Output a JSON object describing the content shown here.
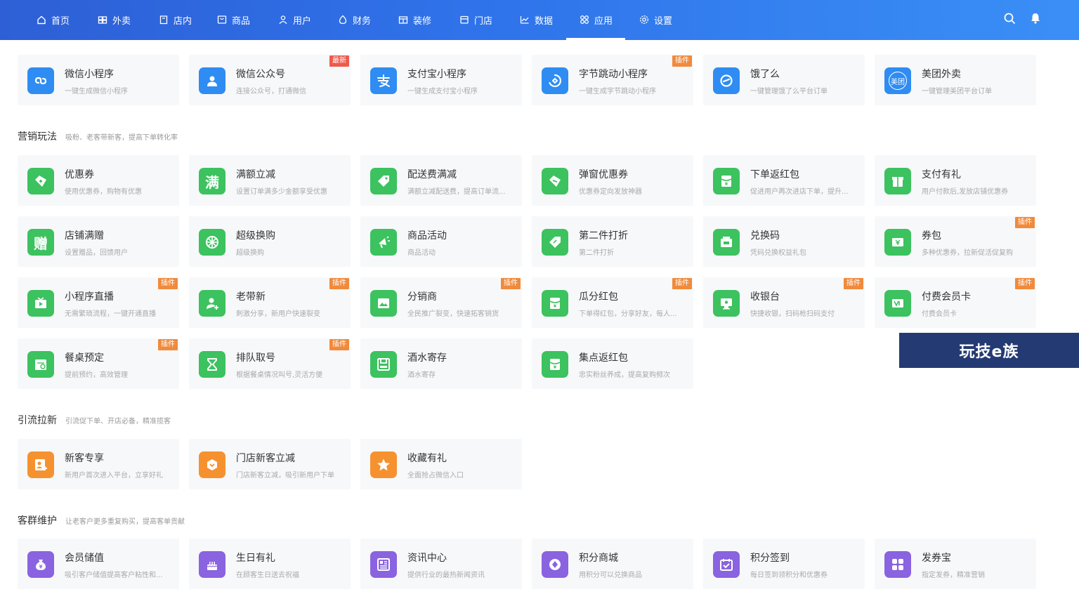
{
  "nav": {
    "items": [
      {
        "label": "首页",
        "icon": "home-icon"
      },
      {
        "label": "外卖",
        "icon": "takeout-icon"
      },
      {
        "label": "店内",
        "icon": "store-inside-icon"
      },
      {
        "label": "商品",
        "icon": "goods-icon"
      },
      {
        "label": "用户",
        "icon": "user-icon"
      },
      {
        "label": "财务",
        "icon": "finance-icon"
      },
      {
        "label": "装修",
        "icon": "decorate-icon"
      },
      {
        "label": "门店",
        "icon": "shop-icon"
      },
      {
        "label": "数据",
        "icon": "chart-icon"
      },
      {
        "label": "应用",
        "icon": "apps-icon"
      },
      {
        "label": "设置",
        "icon": "gear-icon"
      }
    ],
    "active": "应用"
  },
  "sections": {
    "channels": {
      "cards": [
        {
          "title": "微信小程序",
          "desc": "一键生成微信小程序",
          "icon": "wechat-miniapp-icon",
          "color": "#2f8cf2",
          "badge": ""
        },
        {
          "title": "微信公众号",
          "desc": "连接公众号，打通微信",
          "icon": "wechat-account-icon",
          "color": "#2f8cf2",
          "badge": "最新"
        },
        {
          "title": "支付宝小程序",
          "desc": "一键生成支付宝小程序",
          "icon": "alipay-icon",
          "color": "#2f8cf2",
          "badge": ""
        },
        {
          "title": "字节跳动小程序",
          "desc": "一键生成字节跳动小程序",
          "icon": "bytedance-icon",
          "color": "#2f8cf2",
          "badge": "插件"
        },
        {
          "title": "饿了么",
          "desc": "一键管理饿了么平台订单",
          "icon": "eleme-icon",
          "color": "#2f8cf2",
          "badge": ""
        },
        {
          "title": "美团外卖",
          "desc": "一键管理美团平台订单",
          "icon": "meituan-icon",
          "color": "#2f8cf2",
          "badge": "",
          "icon_text": "美团"
        }
      ]
    },
    "marketing": {
      "title": "营销玩法",
      "subtitle": "吸粉、老客带新客，提高下单转化率",
      "cards": [
        {
          "title": "优惠券",
          "desc": "使用优惠券，购物有优惠",
          "icon": "coupon-icon",
          "color": "#3cc25f",
          "badge": ""
        },
        {
          "title": "满额立减",
          "desc": "设置订单满多少金额享受优惠",
          "icon": "full-reduce-icon",
          "color": "#3cc25f",
          "badge": "",
          "icon_text": "满"
        },
        {
          "title": "配送费满减",
          "desc": "满额立减配送费，提高订单流...",
          "icon": "delivery-tag-icon",
          "color": "#3cc25f",
          "badge": ""
        },
        {
          "title": "弹窗优惠券",
          "desc": "优惠券定向发放神器",
          "icon": "popup-coupon-icon",
          "color": "#3cc25f",
          "badge": ""
        },
        {
          "title": "下单返红包",
          "desc": "促进用户再次进店下单，提升...",
          "icon": "redpacket-icon",
          "color": "#3cc25f",
          "badge": ""
        },
        {
          "title": "支付有礼",
          "desc": "用户付款后,发放店铺优惠券",
          "icon": "pay-gift-icon",
          "color": "#3cc25f",
          "badge": ""
        },
        {
          "title": "店铺满赠",
          "desc": "设置赠品，回馈用户",
          "icon": "gift-icon",
          "color": "#3cc25f",
          "badge": "",
          "icon_text": "赠"
        },
        {
          "title": "超级换购",
          "desc": "超级换购",
          "icon": "exchange-icon",
          "color": "#3cc25f",
          "badge": ""
        },
        {
          "title": "商品活动",
          "desc": "商品活动",
          "icon": "megaphone-icon",
          "color": "#3cc25f",
          "badge": ""
        },
        {
          "title": "第二件打折",
          "desc": "第二件打折",
          "icon": "discount-tag-icon",
          "color": "#3cc25f",
          "badge": ""
        },
        {
          "title": "兑换码",
          "desc": "凭码兑换权益礼包",
          "icon": "redeem-code-icon",
          "color": "#3cc25f",
          "badge": ""
        },
        {
          "title": "券包",
          "desc": "多种优惠券，拉新促活促复购",
          "icon": "coupon-pack-icon",
          "color": "#3cc25f",
          "badge": "插件"
        },
        {
          "title": "小程序直播",
          "desc": "无需繁琐流程，一键开通直播",
          "icon": "live-icon",
          "color": "#3cc25f",
          "badge": "插件"
        },
        {
          "title": "老带新",
          "desc": "刺激分享，新用户快速裂变",
          "icon": "invite-icon",
          "color": "#3cc25f",
          "badge": "插件"
        },
        {
          "title": "分销商",
          "desc": "全民推广裂变，快速拓客销货",
          "icon": "distributor-icon",
          "color": "#3cc25f",
          "badge": "插件"
        },
        {
          "title": "瓜分红包",
          "desc": "下单得红包，分享好友，每人...",
          "icon": "split-redpacket-icon",
          "color": "#3cc25f",
          "badge": "插件"
        },
        {
          "title": "收银台",
          "desc": "快捷收银，扫码枪扫码支付",
          "icon": "cashier-icon",
          "color": "#3cc25f",
          "badge": "插件"
        },
        {
          "title": "付费会员卡",
          "desc": "付费会员卡",
          "icon": "vip-card-icon",
          "color": "#3cc25f",
          "badge": "插件"
        },
        {
          "title": "餐桌预定",
          "desc": "提前预约，高效管理",
          "icon": "reservation-icon",
          "color": "#3cc25f",
          "badge": "插件"
        },
        {
          "title": "排队取号",
          "desc": "根据餐桌情况叫号,灵活方便",
          "icon": "hourglass-icon",
          "color": "#3cc25f",
          "badge": "插件"
        },
        {
          "title": "酒水寄存",
          "desc": "酒水寄存",
          "icon": "storage-icon",
          "color": "#3cc25f",
          "badge": ""
        },
        {
          "title": "集点返红包",
          "desc": "忠实粉丝养成，提高复购频次",
          "icon": "points-redpacket-icon",
          "color": "#3cc25f",
          "badge": ""
        }
      ]
    },
    "traffic": {
      "title": "引流拉新",
      "subtitle": "引流促下单、开店必备，精准揽客",
      "cards": [
        {
          "title": "新客专享",
          "desc": "新用户首次进入平台，立享好礼",
          "icon": "new-customer-icon",
          "color": "#f5922f",
          "badge": ""
        },
        {
          "title": "门店新客立减",
          "desc": "门店新客立减，吸引新用户下单",
          "icon": "store-new-reduce-icon",
          "color": "#f5922f",
          "badge": ""
        },
        {
          "title": "收藏有礼",
          "desc": "全面抢占微信入口",
          "icon": "star-icon",
          "color": "#f5922f",
          "badge": ""
        }
      ]
    },
    "retention": {
      "title": "客群维护",
      "subtitle": "让老客户更多重复购买，提高客单贡献",
      "cards": [
        {
          "title": "会员储值",
          "desc": "吸引客户储值提高客户粘性和...",
          "icon": "stored-value-icon",
          "color": "#8a63e0",
          "badge": ""
        },
        {
          "title": "生日有礼",
          "desc": "在顾客生日送去祝福",
          "icon": "cake-icon",
          "color": "#8a63e0",
          "badge": ""
        },
        {
          "title": "资讯中心",
          "desc": "提供行业的最热新闻资讯",
          "icon": "news-icon",
          "color": "#8a63e0",
          "badge": ""
        },
        {
          "title": "积分商城",
          "desc": "用积分可以兑换商品",
          "icon": "points-mall-icon",
          "color": "#8a63e0",
          "badge": ""
        },
        {
          "title": "积分签到",
          "desc": "每日签到领积分和优惠券",
          "icon": "checkin-icon",
          "color": "#8a63e0",
          "badge": ""
        },
        {
          "title": "发券宝",
          "desc": "指定发券，精准营销",
          "icon": "coupon-send-icon",
          "color": "#8a63e0",
          "badge": ""
        }
      ]
    }
  },
  "watermark": "玩技e族"
}
